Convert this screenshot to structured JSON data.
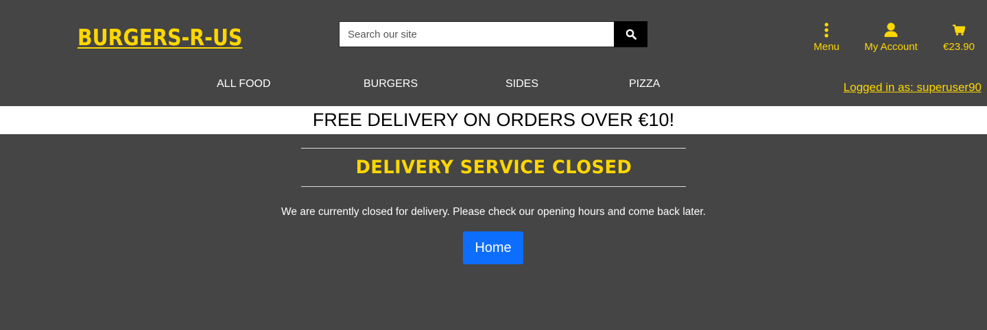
{
  "header": {
    "logo": "BURGERS-R-US",
    "search": {
      "placeholder": "Search our site",
      "value": ""
    },
    "tools": {
      "menu_label": "Menu",
      "account_label": "My Account",
      "cart_total": "€23.90"
    },
    "nav": [
      "ALL FOOD",
      "BURGERS",
      "SIDES",
      "PIZZA"
    ],
    "logged_in": "Logged in as: superuser90"
  },
  "banner": "FREE DELIVERY ON ORDERS OVER €10!",
  "main": {
    "title": "DELIVERY SERVICE CLOSED",
    "message": "We are currently closed for delivery. Please check our opening hours and come back later.",
    "home_button": "Home"
  },
  "colors": {
    "background": "#454545",
    "accent": "#FFD700",
    "button": "#0d6efd"
  },
  "icons": [
    "search-icon",
    "menu-dots-icon",
    "user-icon",
    "cart-icon"
  ]
}
